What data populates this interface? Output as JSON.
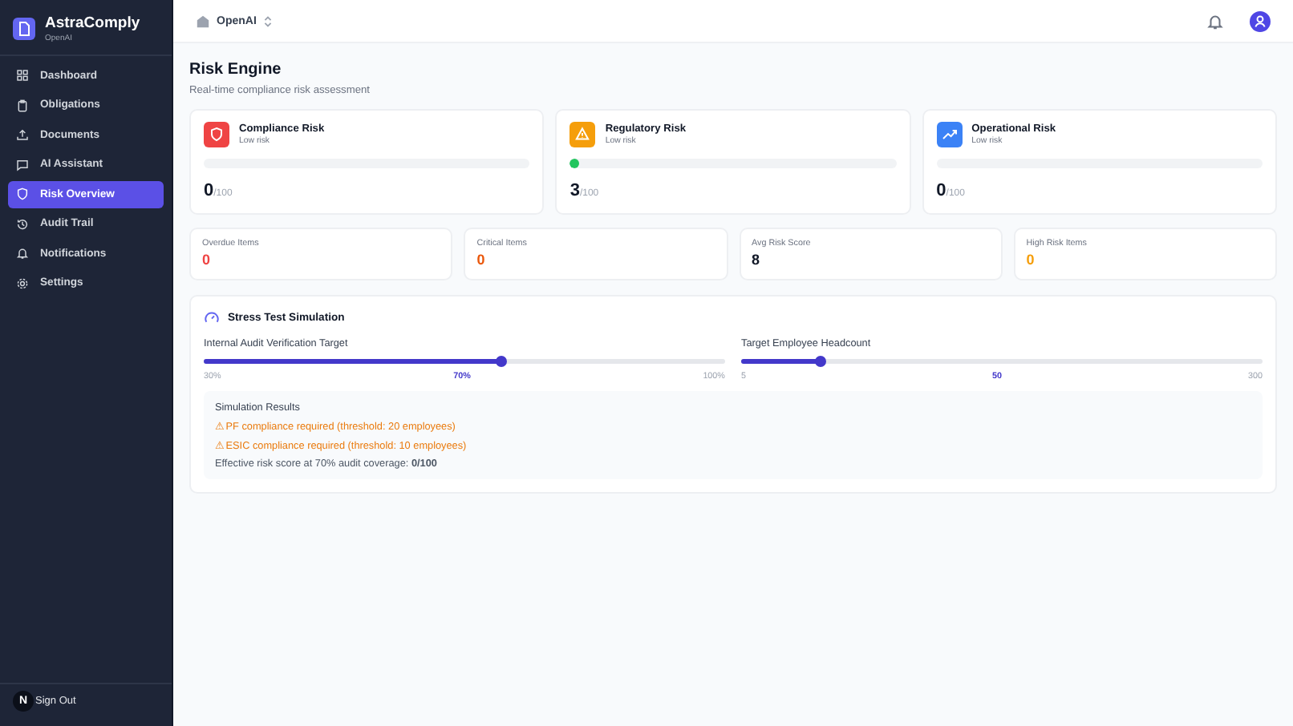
{
  "brand": {
    "name": "AstraComply",
    "org": "OpenAI"
  },
  "sidebar": {
    "items": [
      {
        "label": "Dashboard",
        "kind": "grid",
        "selected": false
      },
      {
        "label": "Obligations",
        "kind": "clipboard",
        "selected": false
      },
      {
        "label": "Documents",
        "kind": "upload",
        "selected": false
      },
      {
        "label": "AI Assistant",
        "kind": "chat",
        "selected": false
      },
      {
        "label": "Risk Overview",
        "kind": "shield",
        "selected": true
      },
      {
        "label": "Audit Trail",
        "kind": "history",
        "selected": false
      },
      {
        "label": "Notifications",
        "kind": "bell",
        "selected": false
      },
      {
        "label": "Settings",
        "kind": "gear",
        "selected": false
      }
    ],
    "user_initial": "N",
    "sign_out": "Sign Out"
  },
  "topbar": {
    "org": "OpenAI"
  },
  "page": {
    "title": "Risk Engine",
    "subtitle": "Real-time compliance risk assessment"
  },
  "risk_cards": [
    {
      "title": "Compliance Risk",
      "status": "Low risk",
      "kind": "shield",
      "color": "#ef4444",
      "score": "0",
      "max": "/100"
    },
    {
      "title": "Regulatory Risk",
      "status": "Low risk",
      "kind": "warning",
      "color": "#f59e0b",
      "level": 0.03,
      "score": "3",
      "max": "/100"
    },
    {
      "title": "Operational Risk",
      "status": "Low risk",
      "kind": "trend",
      "color": "#3b82f6",
      "score": "0",
      "max": "/100"
    }
  ],
  "stats": [
    {
      "label": "Overdue Items",
      "value": "0",
      "color": "#ef4444"
    },
    {
      "label": "Critical Items",
      "value": "0",
      "color": "#ea580c"
    },
    {
      "label": "Avg Risk Score",
      "value": "8",
      "color": "#111827"
    },
    {
      "label": "High Risk Items",
      "value": "0",
      "color": "#f59e0b"
    }
  ],
  "stress_test": {
    "title": "Stress Test Simulation",
    "sliders": [
      {
        "label": "Internal Audit Verification Target",
        "level": 0.571,
        "min": "30%",
        "value": "70%",
        "max": "100%"
      },
      {
        "label": "Target Employee Headcount",
        "level": 0.153,
        "min": "5",
        "value": "50",
        "max": "300"
      }
    ],
    "results": {
      "title": "Simulation Results",
      "warnings": [
        "⚠ PF compliance required (threshold: 20 employees)",
        "⚠ ESIC compliance required (threshold: 10 employees)"
      ],
      "summary": "Effective risk score at 70% audit coverage: **0/100**"
    }
  }
}
